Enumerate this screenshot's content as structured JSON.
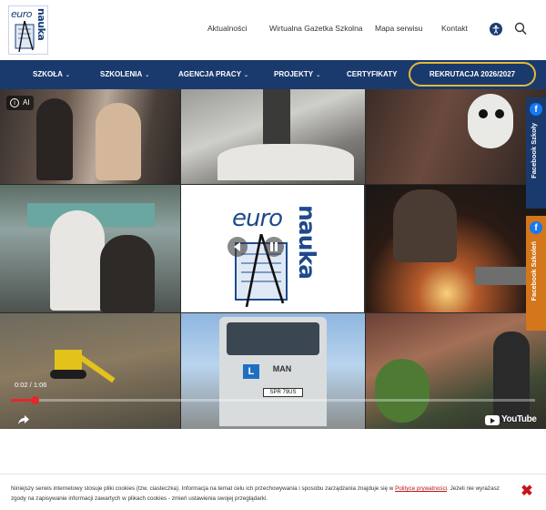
{
  "brand": {
    "logo_top": "euro",
    "logo_side": "nauka"
  },
  "top_nav": [
    {
      "label": "Aktualności"
    },
    {
      "label": "Wirtualna Gazetka Szkolna"
    },
    {
      "label": "Mapa serwisu"
    },
    {
      "label": "Kontakt"
    }
  ],
  "main_nav": [
    {
      "label": "SZKOŁA",
      "chevron": "⌄"
    },
    {
      "label": "SZKOLENIA",
      "chevron": "⌄"
    },
    {
      "label": "AGENCJA PRACY",
      "chevron": "⌄"
    },
    {
      "label": "PROJEKTY",
      "chevron": "⌄"
    },
    {
      "label": "CERTYFIKATY",
      "chevron": ""
    }
  ],
  "recruitment_button": "REKRUTACJA 2026/2027",
  "video": {
    "ai_badge": "AI",
    "current_time": "0:02 / 1:06",
    "progress_fraction": 0.045,
    "youtube_label": "YouTube",
    "truck_plate": "SPR 79US",
    "truck_brand": "MAN",
    "truck_sign": "L"
  },
  "side_tabs": [
    {
      "label": "Facebook Szkoły",
      "color": "#1a3a6e"
    },
    {
      "label": "Facebook Szkoleń",
      "color": "#d3761c"
    }
  ],
  "cookie": {
    "text_before": "Niniejszy serwis internetowy stosuje pliki cookies (tzw. ciasteczka). Informacja na temat celu ich przechowywania i sposobu zarządzania znajduje się w ",
    "link": "Polityce prywatności",
    "text_after": ". Jeżeli nie wyrażasz zgody na zapisywanie informacji zawartych w plikach cookies - zmień ustawienia swojej przeglądarki.",
    "close_glyph": "✖"
  },
  "colors": {
    "navy": "#1a3a6e",
    "gold": "#e2b93b",
    "orange": "#d3761c",
    "red": "#c8141b"
  }
}
